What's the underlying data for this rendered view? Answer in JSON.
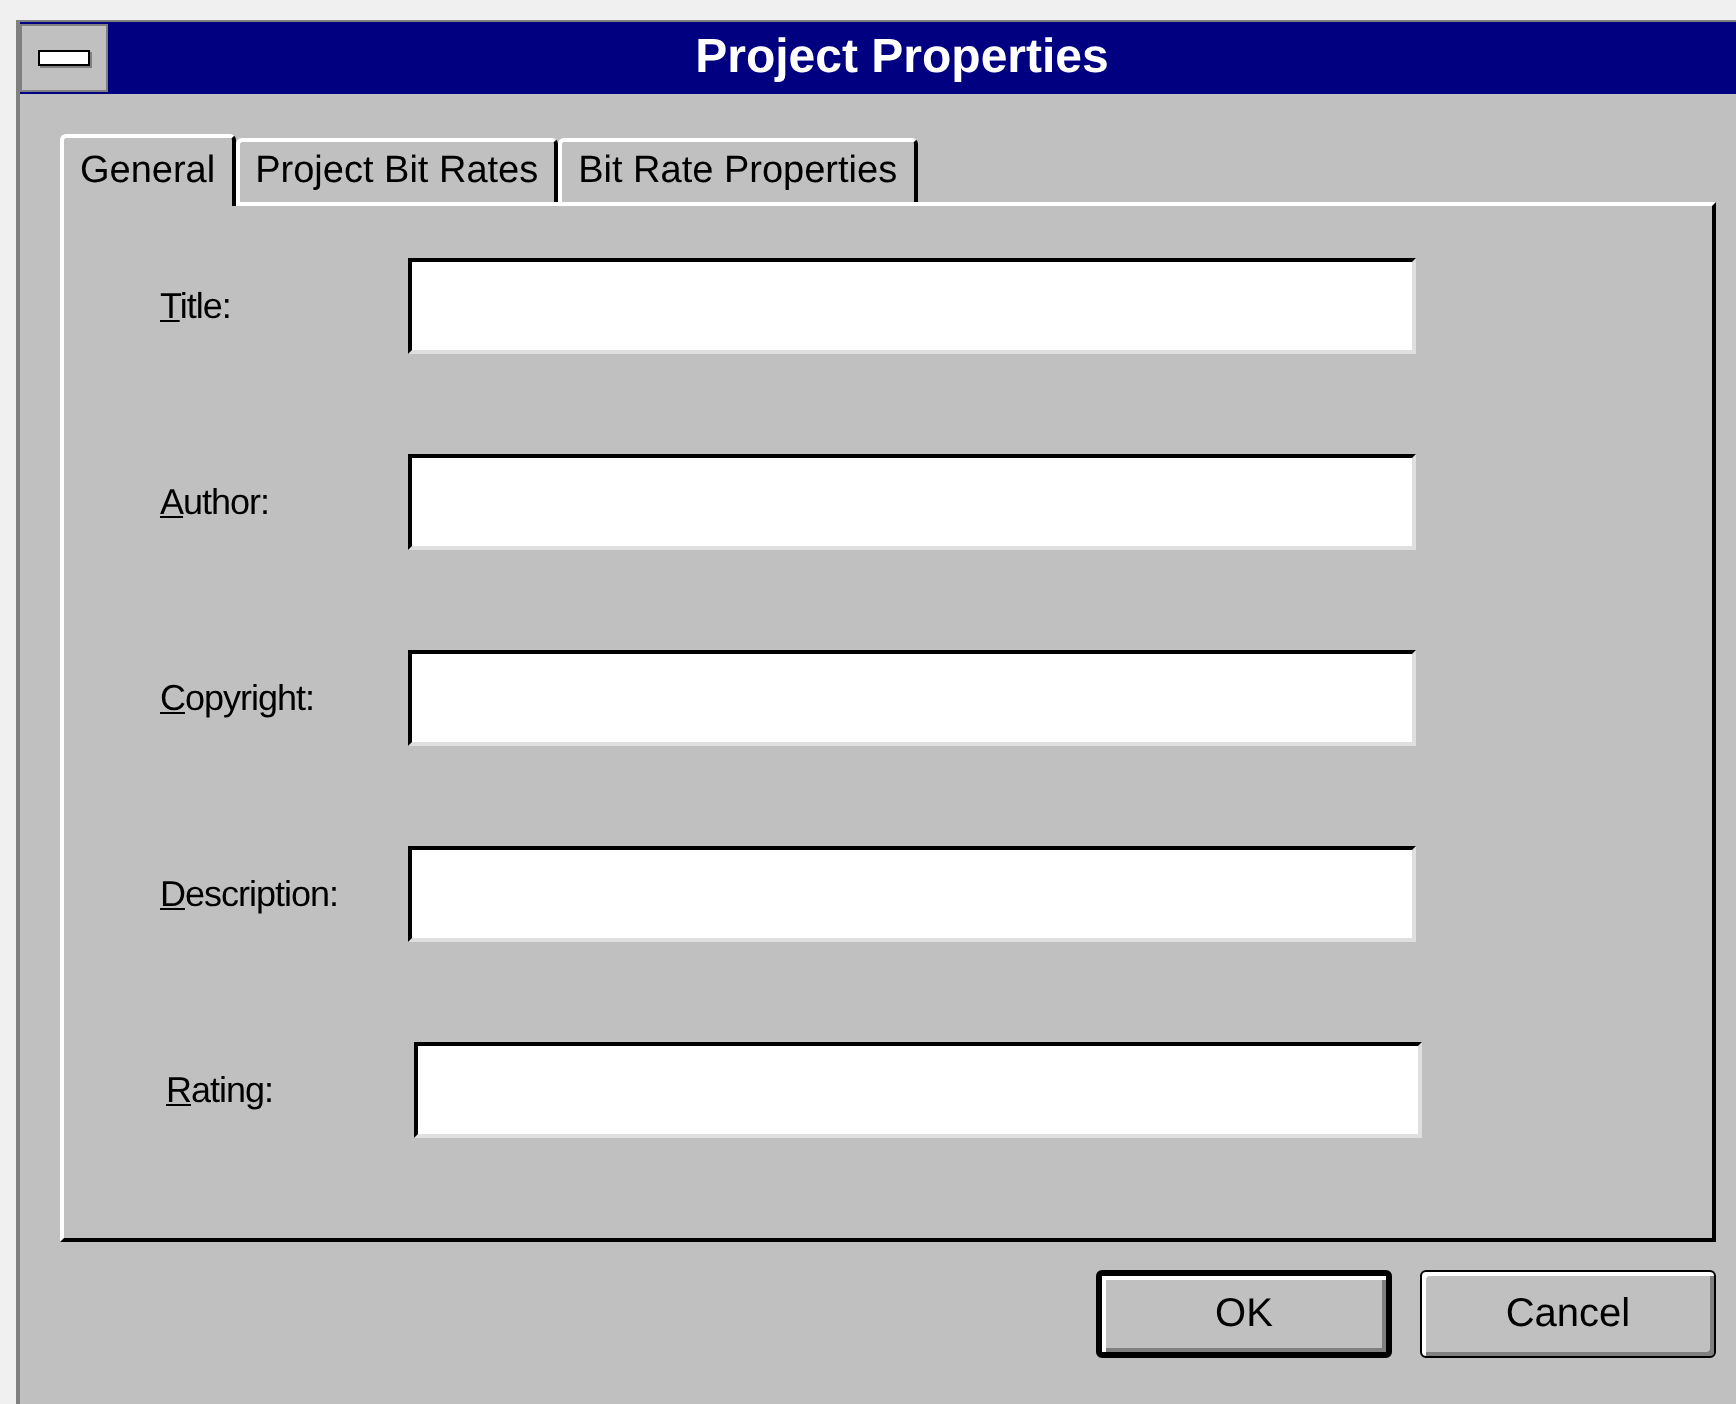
{
  "window": {
    "title": "Project Properties"
  },
  "tabs": [
    {
      "label": "General",
      "selected": true
    },
    {
      "label": "Project Bit Rates",
      "selected": false
    },
    {
      "label": "Bit Rate Properties",
      "selected": false
    }
  ],
  "fields": [
    {
      "label": "Title:"
    },
    {
      "label": "Author:"
    },
    {
      "label": "Copyright:"
    },
    {
      "label": "Description:"
    },
    {
      "label": "Rating:"
    }
  ],
  "buttons": [
    {
      "label": "OK",
      "default": true
    },
    {
      "label": "Cancel",
      "default": false
    }
  ]
}
